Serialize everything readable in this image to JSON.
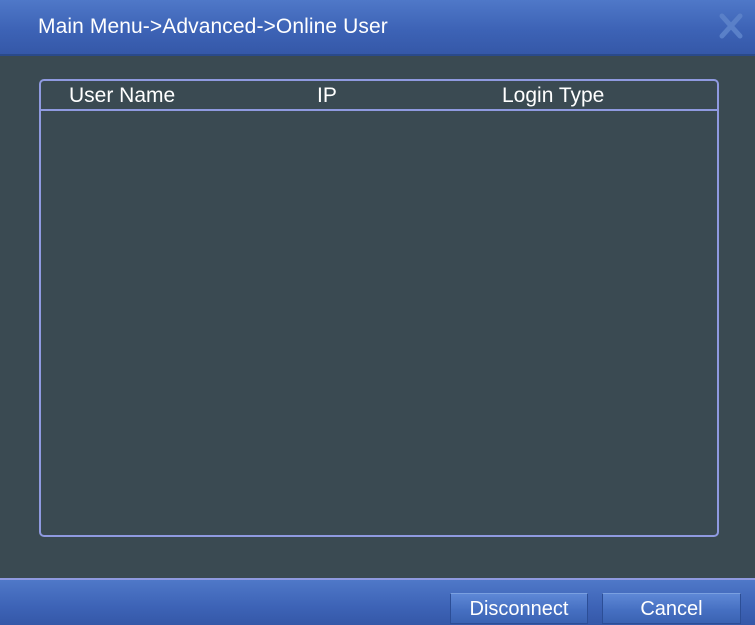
{
  "window": {
    "title": "Main Menu->Advanced->Online User",
    "close_icon": "close-icon"
  },
  "online_user_list": {
    "columns": [
      "User Name",
      "IP",
      "Login Type"
    ],
    "rows": []
  },
  "footer": {
    "disconnect_label": "Disconnect",
    "cancel_label": "Cancel"
  },
  "colors": {
    "accent": "#3d63b6",
    "background": "#3a4a52",
    "border": "#8f9ae0",
    "text": "#ffffff"
  }
}
